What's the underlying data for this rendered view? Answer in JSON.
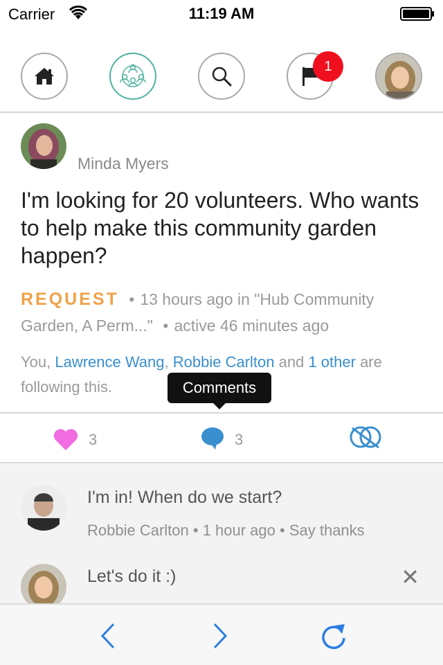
{
  "status_bar": {
    "carrier": "Carrier",
    "time": "11:19 AM"
  },
  "nav": {
    "icons": [
      "home-icon",
      "community-icon",
      "search-icon",
      "flag-icon",
      "profile-avatar"
    ],
    "notification_count": "1",
    "accent_color": "#4fb39f",
    "badge_color": "#f00f1e"
  },
  "post": {
    "author": "Minda Myers",
    "text": "I'm looking for 20 volunteers. Who wants to help make this community garden happen?",
    "type_label": "REQUEST",
    "time": "13 hours ago in \"Hub Community Garden, A Perm...\"",
    "activity": "active 46 minutes ago",
    "followers_prefix": "You, ",
    "follower_1": "Lawrence Wang",
    "separator": ", ",
    "follower_2": "Robbie Carlton",
    "and_text": " and ",
    "others": "1 other",
    "followers_suffix": " are following this.",
    "type_color": "#f0a14a",
    "link_color": "#3a8fcf"
  },
  "tooltip": {
    "label": "Comments"
  },
  "actions": {
    "like_count": "3",
    "comment_count": "3",
    "like_color": "#f06ce0",
    "comment_color": "#3a8fcf"
  },
  "comments": [
    {
      "text": "I'm in! When do we start?",
      "author": "Robbie Carlton",
      "time": "1 hour ago",
      "thanks": "Say thanks"
    },
    {
      "text": "Let's do it :)",
      "close": "✕"
    }
  ],
  "toolbar": {
    "icons": [
      "back-icon",
      "forward-icon",
      "refresh-icon"
    ],
    "color": "#2b7de3"
  }
}
